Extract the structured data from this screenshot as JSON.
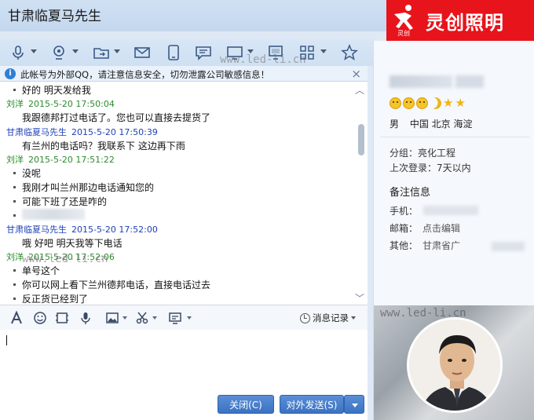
{
  "window": {
    "title": "甘肃临夏马先生"
  },
  "brand": {
    "sub": "灵创",
    "name": "灵创照明",
    "color": "#e8141b"
  },
  "watermark": "www.led-li.cn",
  "toolbar": {
    "icons": [
      "microphone-icon",
      "camera-icon",
      "folder-icon",
      "mail-icon",
      "phone-device-icon",
      "chat-bubble-icon",
      "screen-share-icon",
      "monitor-icon",
      "apps-grid-icon",
      "star-icon"
    ]
  },
  "notice": {
    "text": "此帐号为外部QQ，请注意信息安全，切勿泄露公司敏感信息！",
    "close": "×"
  },
  "chat": {
    "messages": [
      {
        "kind": "line",
        "text": "好的  明天发给我"
      },
      {
        "kind": "header",
        "sender": "刘洋",
        "time": "2015-5-20 17:50:04"
      },
      {
        "kind": "line",
        "text": "我跟德邦打过电话了。您也可以直接去提货了"
      },
      {
        "kind": "header",
        "sender": "甘肃临夏马先生",
        "time": "2015-5-20 17:50:39"
      },
      {
        "kind": "line",
        "text": "有兰州的电话吗？我联系下   这边再下雨"
      },
      {
        "kind": "header",
        "sender": "刘洋",
        "time": "2015-5-20 17:51:22"
      },
      {
        "kind": "line",
        "text": "没呢"
      },
      {
        "kind": "line",
        "text": "我刚才叫兰州那边电话通知您的"
      },
      {
        "kind": "line",
        "text": "可能下班了还是咋的"
      },
      {
        "kind": "header",
        "sender": "甘肃临夏马先生",
        "time": "2015-5-20 17:52:00"
      },
      {
        "kind": "line",
        "text": "哦  好吧  明天我等下电话"
      },
      {
        "kind": "header",
        "sender": "刘洋",
        "time": "2015-5-20 17:52:06"
      },
      {
        "kind": "line",
        "text": "单号这个"
      },
      {
        "kind": "line",
        "text": "你可以网上看下兰州德邦电话，直接电话过去"
      },
      {
        "kind": "line",
        "text": "反正货已经到了"
      }
    ]
  },
  "input_toolbar": {
    "icons": [
      "font-icon",
      "emoji-icon",
      "gif-icon",
      "voice-icon",
      "image-icon",
      "scissors-icon",
      "screenshot-icon"
    ],
    "history_label": "消息记录"
  },
  "buttons": {
    "close": "关闭(C)",
    "send": "对外发送(S)"
  },
  "profile": {
    "gender": "男",
    "location": "中国 北京 海淀",
    "group_label": "分组：",
    "group_value": "亮化工程",
    "last_login_label": "上次登录：",
    "last_login_value": "7天以内",
    "remark_title": "备注信息",
    "phone_label": "手机：",
    "email_label": "邮箱：",
    "email_value": "点击编辑",
    "other_label": "其他：",
    "other_value": "甘肃省广"
  }
}
